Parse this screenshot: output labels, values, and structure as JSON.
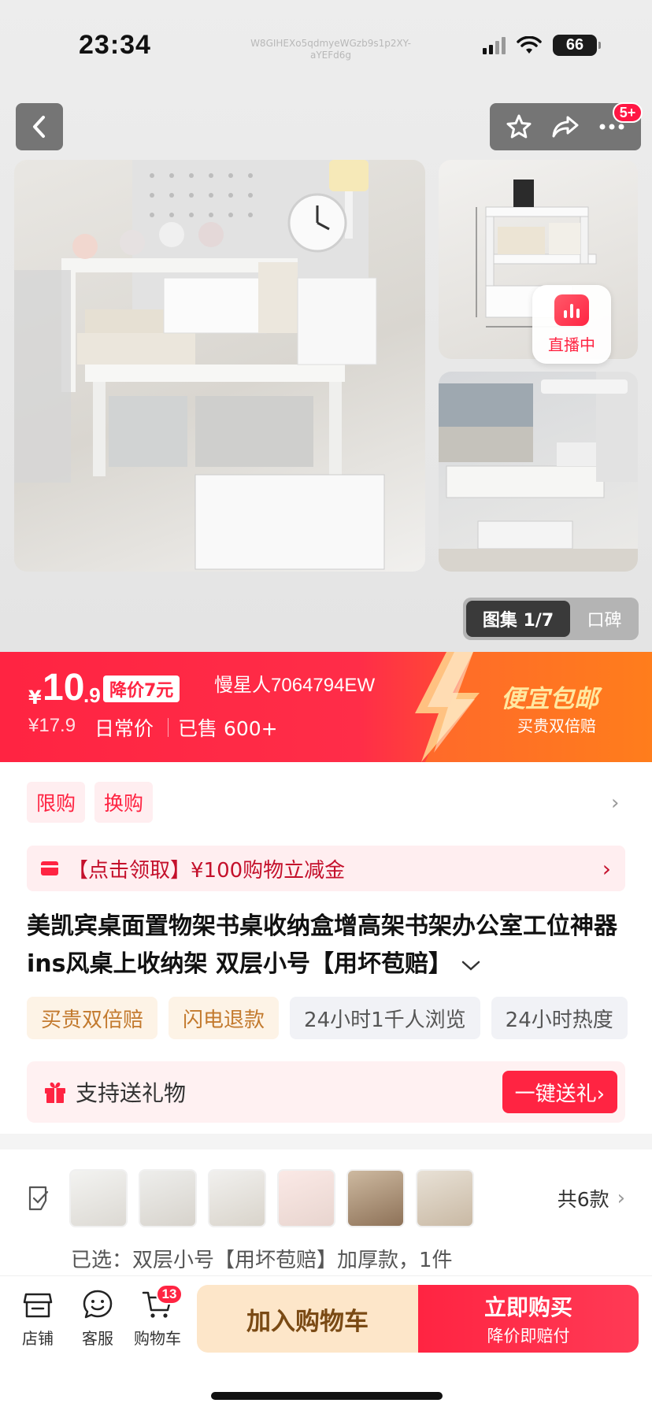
{
  "status_bar": {
    "time": "23:34",
    "battery": "66",
    "watermark": "W8GIHEXo5qdmyeWGzb9s1p2XY-aYEFd6g"
  },
  "header": {
    "more_badge": "5+"
  },
  "gallery": {
    "live_label": "直播中",
    "tab_active": "图集 1/7",
    "tab_inactive": "口碑"
  },
  "price_banner": {
    "currency": "¥",
    "price_integer": "10",
    "price_decimal": ".9",
    "drop_tag": "降价7元",
    "seller": "慢星人7064794EW",
    "original_price": "¥17.9",
    "daily_label": "日常价",
    "sold": "已售 600+",
    "promo_title": "便宜包邮",
    "promo_sub": "买贵双倍赔"
  },
  "tags": [
    "限购",
    "换购"
  ],
  "coupon": {
    "text": "【点击领取】¥100购物立减金"
  },
  "product": {
    "title": "美凯宾桌面置物架书桌收纳盒增高架书架办公室工位神器ins风桌上收纳架 双层小号【用坏苞赔】"
  },
  "services": {
    "orange": [
      "买贵双倍赔",
      "闪电退款"
    ],
    "gray": [
      "24小时1千人浏览",
      "24小时热度"
    ]
  },
  "gift": {
    "text": "支持送礼物",
    "button": "一键送礼›"
  },
  "variants": {
    "count_label": "共6款",
    "selected": "已选：双层小号【用坏苞赔】加厚款，1件"
  },
  "bottom_bar": {
    "store": "店铺",
    "service": "客服",
    "cart": "购物车",
    "cart_badge": "13",
    "add_to_cart": "加入购物车",
    "buy_now": "立即购买",
    "buy_now_sub": "降价即赔付"
  },
  "colors": {
    "accent": "#ff2442",
    "promo": "#ff6b1a",
    "cart_button": "#fde6c9"
  }
}
